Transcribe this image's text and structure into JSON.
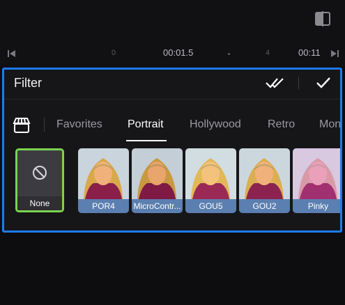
{
  "timeline": {
    "tick_0": "0",
    "current_time": "00:01.5",
    "tick_4": "4",
    "total_time": "00:11"
  },
  "panel": {
    "title": "Filter"
  },
  "tabs": [
    {
      "label": "Favorites"
    },
    {
      "label": "Portrait"
    },
    {
      "label": "Hollywood"
    },
    {
      "label": "Retro"
    },
    {
      "label": "Mon"
    }
  ],
  "filters": [
    {
      "label": "None",
      "selected": true
    },
    {
      "label": "POR4",
      "tint": "#f0b27a"
    },
    {
      "label": "MicroContr...",
      "tint": "#e8a56c"
    },
    {
      "label": "GOU5",
      "tint": "#f3c27d"
    },
    {
      "label": "GOU2",
      "tint": "#f0b27a"
    },
    {
      "label": "Pinky",
      "tint": "#e9a0b8"
    }
  ],
  "colors": {
    "accent_border": "#1e7bf2",
    "selected_border": "#7bd34f",
    "label_bg": "#5b7fb0"
  }
}
